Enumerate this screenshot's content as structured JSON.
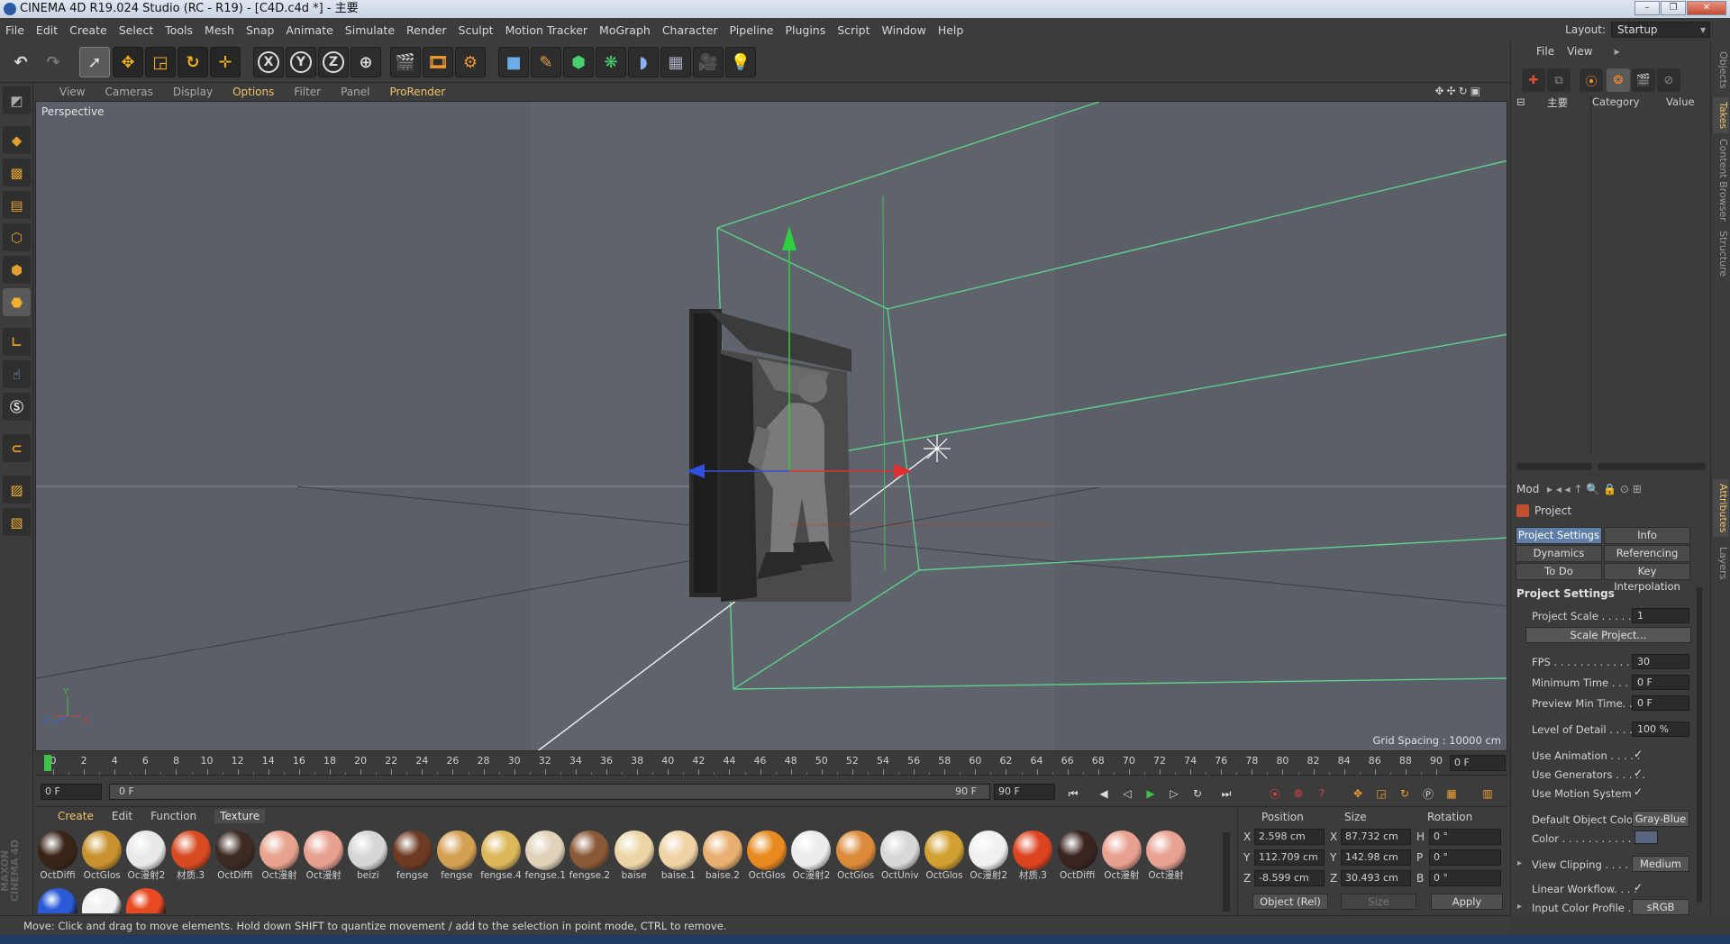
{
  "window": {
    "title": "CINEMA 4D R19.024 Studio (RC - R19) - [C4D.c4d *] - 主要",
    "layout_label": "Layout:",
    "layout_value": "Startup"
  },
  "menu": [
    "File",
    "Edit",
    "Create",
    "Select",
    "Tools",
    "Mesh",
    "Snap",
    "Animate",
    "Simulate",
    "Render",
    "Sculpt",
    "Motion Tracker",
    "MoGraph",
    "Character",
    "Pipeline",
    "Plugins",
    "Script",
    "Window",
    "Help"
  ],
  "toolbar": {
    "undo": "↶",
    "redo": "↷",
    "axis_x": "X",
    "axis_y": "Y",
    "axis_z": "Z"
  },
  "viewport": {
    "menu": [
      "View",
      "Cameras",
      "Display",
      "Options",
      "Filter",
      "Panel",
      "ProRender"
    ],
    "active_menu": "Options",
    "label": "Perspective",
    "grid_spacing": "Grid Spacing : 10000 cm",
    "axis_y": "Y",
    "axis_z": "Z",
    "axis_x": "X"
  },
  "timeline": {
    "ticks": [
      "0",
      "2",
      "4",
      "6",
      "8",
      "10",
      "12",
      "14",
      "16",
      "18",
      "20",
      "22",
      "24",
      "26",
      "28",
      "30",
      "32",
      "34",
      "36",
      "38",
      "40",
      "42",
      "44",
      "46",
      "48",
      "50",
      "52",
      "54",
      "56",
      "58",
      "60",
      "62",
      "64",
      "66",
      "68",
      "70",
      "72",
      "74",
      "76",
      "78",
      "80",
      "82",
      "84",
      "86",
      "88",
      "90"
    ],
    "current_frame": "0 F",
    "start_field": "0 F",
    "slider_left": "0 F",
    "slider_right": "90 F",
    "end_field": "90 F",
    "right_field": "0 F",
    "current_tick": 0
  },
  "materials": {
    "menu": [
      "Create",
      "Edit",
      "Function",
      "Texture"
    ],
    "items": [
      {
        "label": "OctDiffi",
        "color": "#3a2418"
      },
      {
        "label": "OctGlos",
        "color": "#c8922f"
      },
      {
        "label": "Oc漫射2",
        "color": "#e8e8e8"
      },
      {
        "label": "材质.3",
        "color": "#d84a22"
      },
      {
        "label": "OctDiffi",
        "color": "#3d2a22"
      },
      {
        "label": "Oct漫射",
        "color": "#e8a38e"
      },
      {
        "label": "Oct漫射",
        "color": "#e8a090"
      },
      {
        "label": "beizi",
        "color": "#d6d6d6"
      },
      {
        "label": "fengse",
        "color": "#6e3a22"
      },
      {
        "label": "fengse",
        "color": "#d4a052"
      },
      {
        "label": "fengse.4",
        "color": "#dcb85a"
      },
      {
        "label": "fengse.1",
        "color": "#e0d2b8"
      },
      {
        "label": "fengse.2",
        "color": "#8a5a38"
      },
      {
        "label": "baise",
        "color": "#ecd6a8"
      },
      {
        "label": "baise.1",
        "color": "#efd3a4"
      },
      {
        "label": "baise.2",
        "color": "#e8b070"
      },
      {
        "label": "OctGlos",
        "color": "#e88a20"
      },
      {
        "label": "Oc漫射2",
        "color": "#ececec"
      },
      {
        "label": "OctGlos",
        "color": "#dc8a3a"
      },
      {
        "label": "OctUniv",
        "color": "#d8d8d8"
      },
      {
        "label": "OctGlos",
        "color": "#d0a030"
      },
      {
        "label": "Oc漫射2",
        "color": "#f0f0f0"
      },
      {
        "label": "材质.3",
        "color": "#dc4420"
      },
      {
        "label": "OctDiffi",
        "color": "#3a2420"
      },
      {
        "label": "Oct漫射",
        "color": "#e8a090"
      },
      {
        "label": "Oct漫射",
        "color": "#e8a292"
      }
    ],
    "row2": [
      {
        "color": "#2a5ad8"
      },
      {
        "color": "#f0f0f0"
      },
      {
        "color": "#e84a22"
      }
    ]
  },
  "coords": {
    "headers": {
      "position": "Position",
      "size": "Size",
      "rotation": "Rotation"
    },
    "rows": [
      {
        "axis": "X",
        "pos": "2.598 cm",
        "saxis": "X",
        "size": "87.732 cm",
        "raxis": "H",
        "rot": "0 °"
      },
      {
        "axis": "Y",
        "pos": "112.709 cm",
        "saxis": "Y",
        "size": "142.98 cm",
        "raxis": "P",
        "rot": "0 °"
      },
      {
        "axis": "Z",
        "pos": "-8.599 cm",
        "saxis": "Z",
        "size": "30.493 cm",
        "raxis": "B",
        "rot": "0 °"
      }
    ],
    "mode": "Object (Rel)",
    "size_mode": "Size",
    "apply": "Apply"
  },
  "status": "Move: Click and drag to move elements. Hold down SHIFT to quantize movement / add to the selection in point mode, CTRL to remove.",
  "logo": "MAXON CINEMA 4D",
  "objects": {
    "menu": [
      "File",
      "View"
    ],
    "root": "主要",
    "col_category": "Category",
    "col_value": "Value"
  },
  "attributes": {
    "mode": "Mod",
    "object": "Project",
    "tabs": [
      {
        "label": "Project Settings",
        "active": true
      },
      {
        "label": "Info",
        "active": false
      },
      {
        "label": "Dynamics",
        "active": false
      },
      {
        "label": "Referencing",
        "active": false
      },
      {
        "label": "To Do",
        "active": false
      },
      {
        "label": "Key Interpolation",
        "active": false
      }
    ],
    "section": "Project Settings",
    "project_scale_label": "Project Scale . . . . . .",
    "project_scale": "1",
    "scale_btn": "Scale Project...",
    "fps_label": "FPS . . . . . . . . . . . . . . .",
    "fps": "30",
    "min_time_label": "Minimum Time . . . . .",
    "min_time": "0 F",
    "prev_min_label": "Preview Min Time. . .",
    "prev_min": "0 F",
    "lod_label": "Level of Detail . . . . .",
    "lod": "100 %",
    "use_anim_label": "Use Animation . . . . .",
    "use_gen_label": "Use Generators . . . . .",
    "use_motion_label": "Use Motion System",
    "check": "✓",
    "def_color_label": "Default Object Color",
    "def_color": "Gray-Blue",
    "color_label": "Color . . . . . . . . . . .",
    "clip_label": "View Clipping . . . . . .",
    "clip": "Medium",
    "linear_label": "Linear Workflow. . . .",
    "input_profile_label": "Input Color Profile . .",
    "input_profile": "sRGB"
  },
  "sidetabs": [
    "Objects",
    "Takes",
    "Content Browser",
    "Structure",
    "Attributes",
    "Layers"
  ]
}
